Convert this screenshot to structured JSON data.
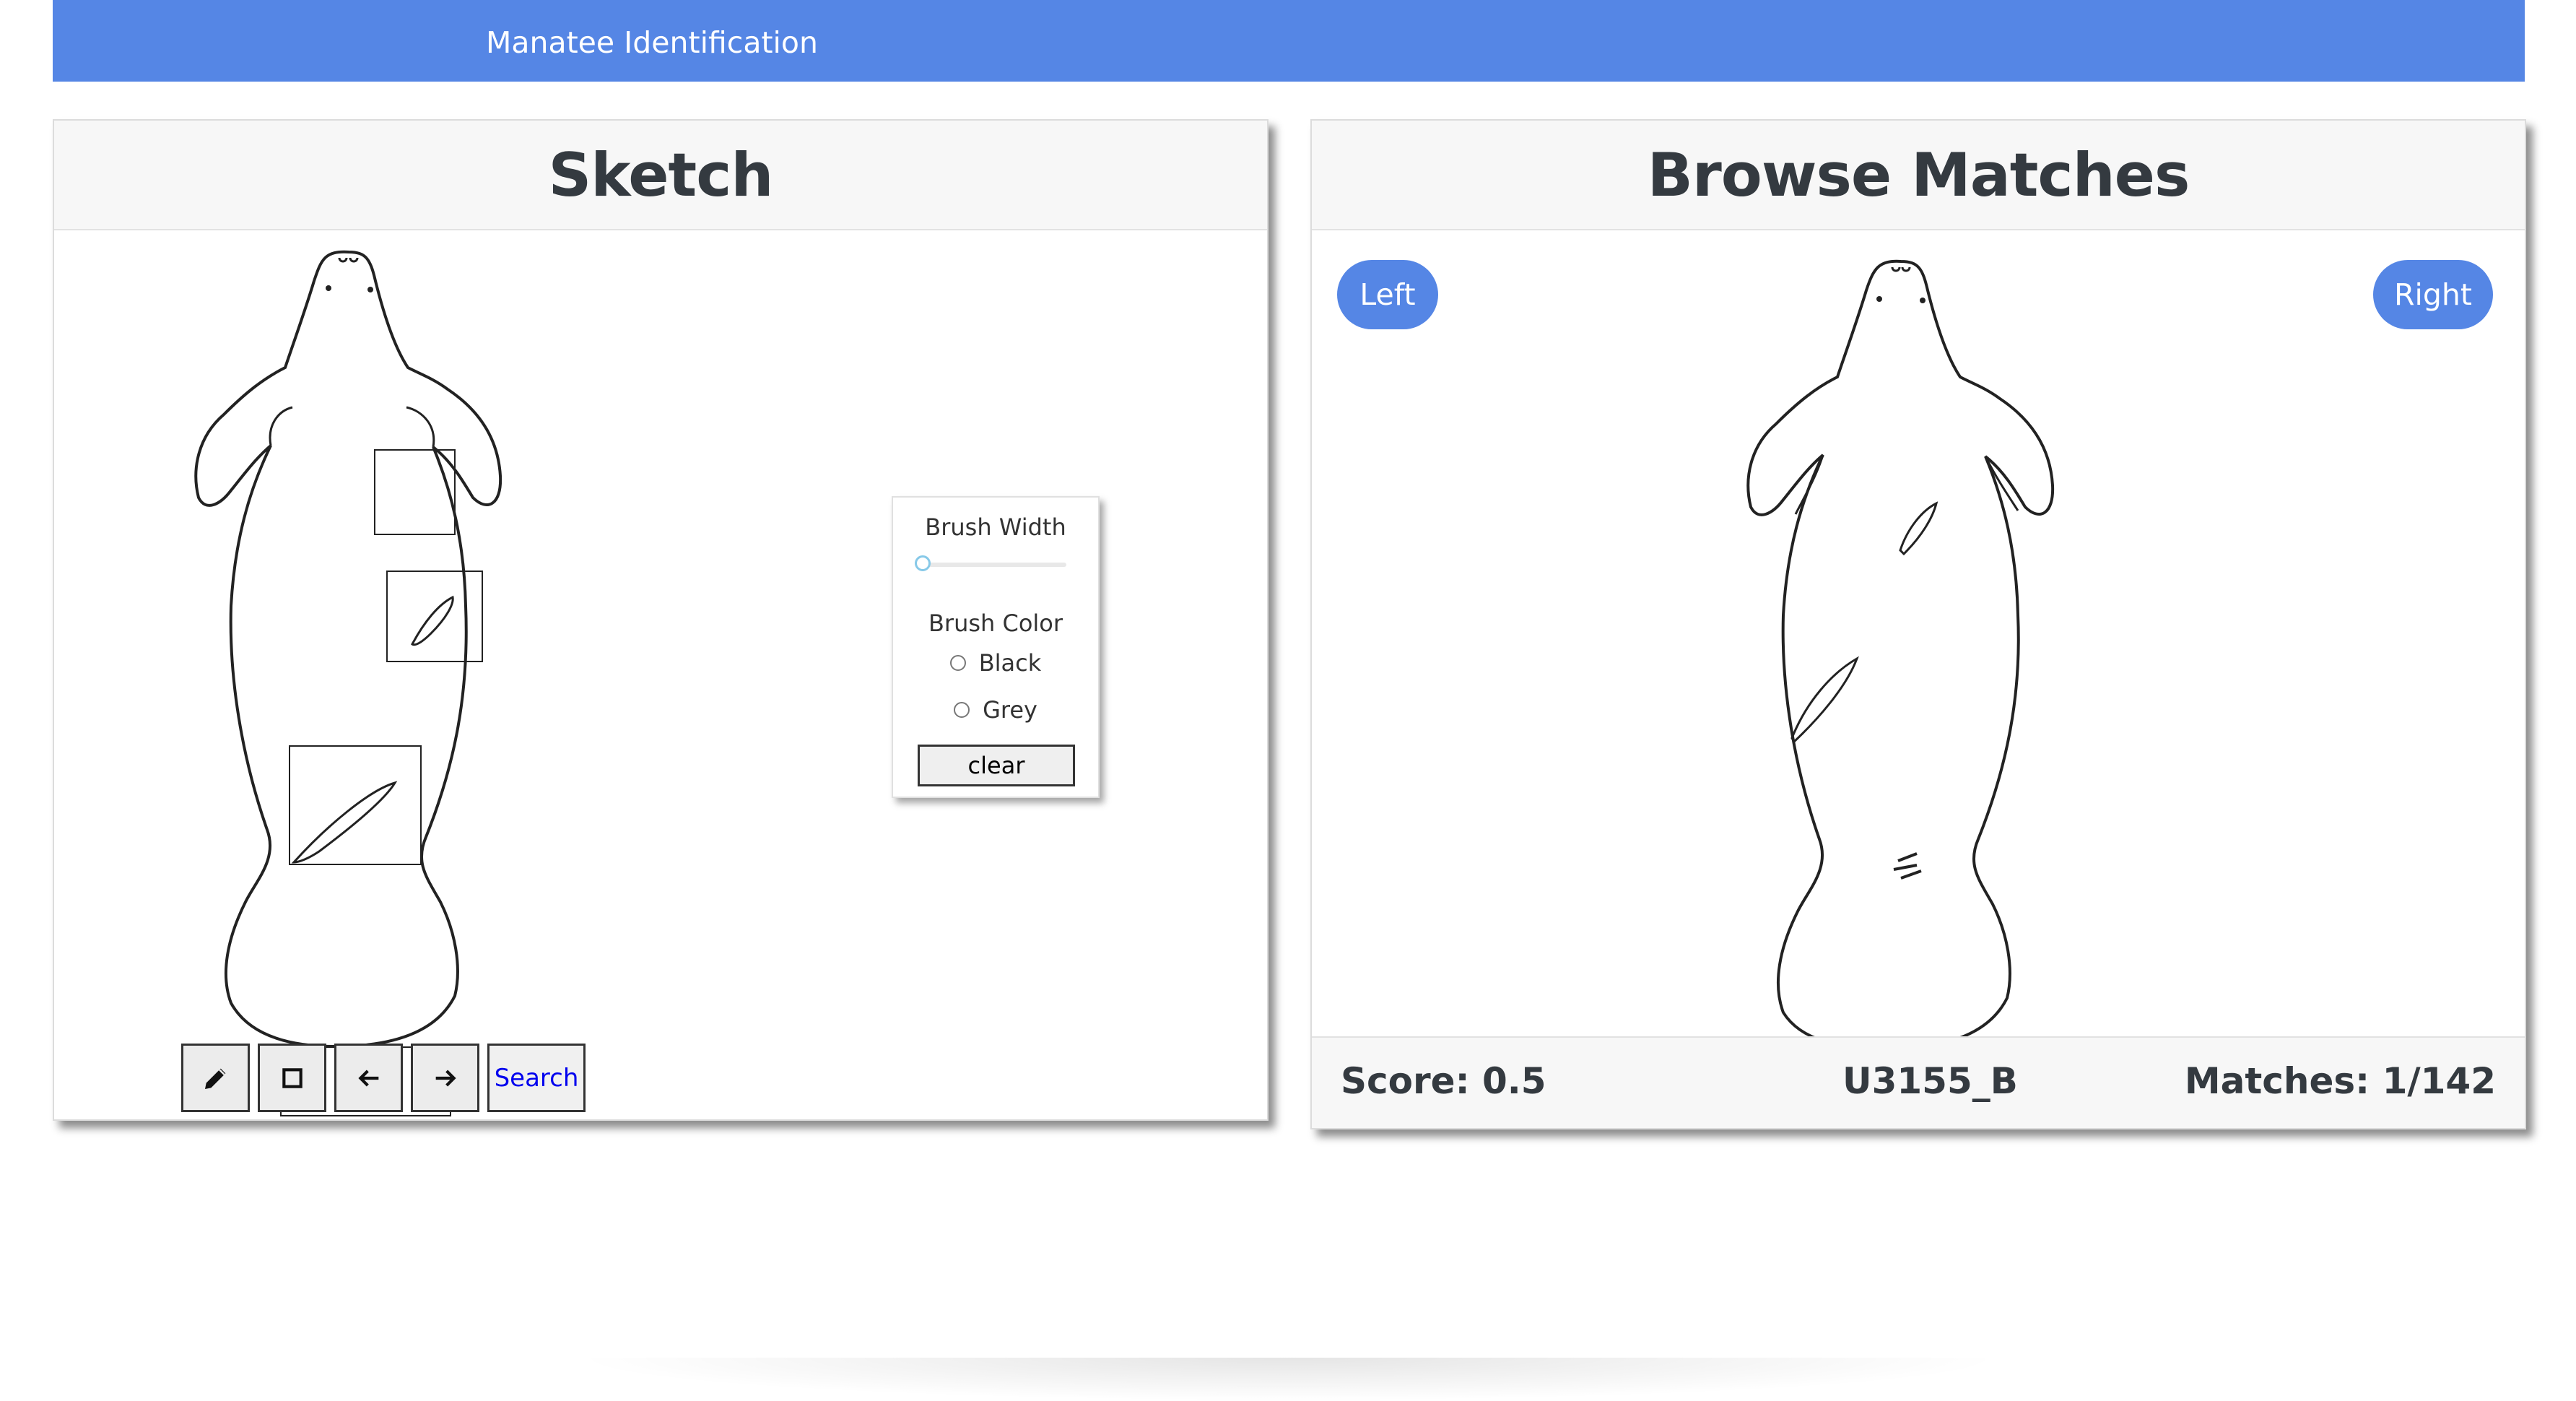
{
  "navbar": {
    "brand": "Manatee Identification"
  },
  "sketch": {
    "title": "Sketch",
    "tools": [
      "pencil-icon",
      "square-icon",
      "arrow-left-icon",
      "arrow-right-icon"
    ],
    "search_label": "Search",
    "brush_panel": {
      "width_label": "Brush Width",
      "width_value": 0,
      "color_label": "Brush Color",
      "options": [
        "Black",
        "Grey"
      ],
      "clear_label": "clear"
    }
  },
  "browse": {
    "title": "Browse Matches",
    "left_label": "Left",
    "right_label": "Right",
    "score": "Score: 0.5",
    "id": "U3155_B",
    "matches": "Matches: 1/142"
  },
  "colors": {
    "navbar": "#5586e5",
    "pill": "#5586e5"
  }
}
